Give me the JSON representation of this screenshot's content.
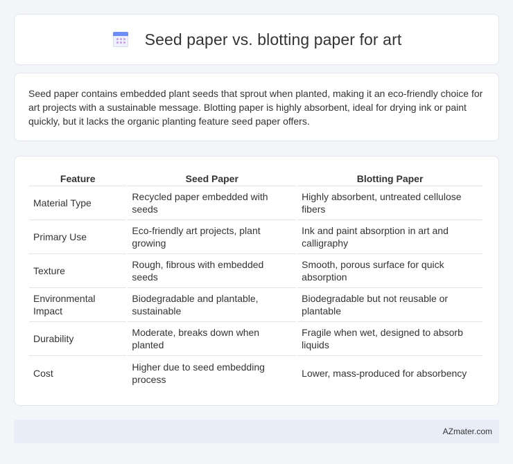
{
  "header": {
    "title": "Seed paper vs. blotting paper for art",
    "icon": "calendar-grid-icon"
  },
  "intro": {
    "text": "Seed paper contains embedded plant seeds that sprout when planted, making it an eco-friendly choice for art projects with a sustainable message. Blotting paper is highly absorbent, ideal for drying ink or paint quickly, but it lacks the organic planting feature seed paper offers."
  },
  "table": {
    "headers": [
      "Feature",
      "Seed Paper",
      "Blotting Paper"
    ],
    "rows": [
      [
        "Material Type",
        "Recycled paper embedded with seeds",
        "Highly absorbent, untreated cellulose fibers"
      ],
      [
        "Primary Use",
        "Eco-friendly art projects, plant growing",
        "Ink and paint absorption in art and calligraphy"
      ],
      [
        "Texture",
        "Rough, fibrous with embedded seeds",
        "Smooth, porous surface for quick absorption"
      ],
      [
        "Environmental Impact",
        "Biodegradable and plantable, sustainable",
        "Biodegradable but not reusable or plantable"
      ],
      [
        "Durability",
        "Moderate, breaks down when planted",
        "Fragile when wet, designed to absorb liquids"
      ],
      [
        "Cost",
        "Higher due to seed embedding process",
        "Lower, mass-produced for absorbency"
      ]
    ]
  },
  "footer": {
    "brand": "AZmater.com"
  }
}
